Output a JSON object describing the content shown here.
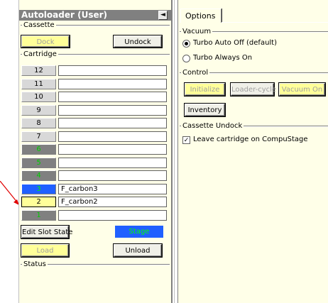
{
  "autoloader": {
    "title": "Autoloader (User)",
    "collapse_glyph": "◄",
    "cassette_label": "Cassette",
    "dock_label": "Dock",
    "undock_label": "Undock",
    "cartridge_label": "Cartridge",
    "slots": [
      {
        "num": "12",
        "name": "",
        "color": "#d8d8d8",
        "text_color": "#000000"
      },
      {
        "num": "11",
        "name": "",
        "color": "#d8d8d8",
        "text_color": "#000000"
      },
      {
        "num": "10",
        "name": "",
        "color": "#d8d8d8",
        "text_color": "#000000"
      },
      {
        "num": "9",
        "name": "",
        "color": "#d8d8d8",
        "text_color": "#000000"
      },
      {
        "num": "8",
        "name": "",
        "color": "#d8d8d8",
        "text_color": "#000000"
      },
      {
        "num": "7",
        "name": "",
        "color": "#d8d8d8",
        "text_color": "#000000"
      },
      {
        "num": "6",
        "name": "",
        "color": "#808080",
        "text_color": "#00cc00"
      },
      {
        "num": "5",
        "name": "",
        "color": "#808080",
        "text_color": "#00cc00"
      },
      {
        "num": "4",
        "name": "",
        "color": "#808080",
        "text_color": "#00cc00"
      },
      {
        "num": "3",
        "name": "F_carbon3",
        "color": "#2060ff",
        "text_color": "#00ee00"
      },
      {
        "num": "2",
        "name": "F_carbon2",
        "color": "#ffff99",
        "text_color": "#000000"
      },
      {
        "num": "1",
        "name": "",
        "color": "#808080",
        "text_color": "#00cc00"
      }
    ],
    "edit_slot_state_label": "Edit Slot State",
    "stage_label": "Stage",
    "stage_color": "#2060ff",
    "load_label": "Load",
    "unload_label": "Unload",
    "status_label": "Status"
  },
  "options": {
    "tab_label": "Options",
    "vacuum_label": "Vacuum",
    "radio_1": {
      "label": "Turbo Auto Off (default)",
      "selected": true
    },
    "radio_2": {
      "label": "Turbo Always On",
      "selected": false
    },
    "control_label": "Control",
    "initialize_label": "Initialize",
    "loader_cycle_label": "Loader-cycle",
    "vacuum_on_label": "Vacuum On",
    "inventory_label": "Inventory",
    "cassette_undock_label": "Cassette Undock",
    "leave_cartridge_label": "Leave cartridge on CompuStage",
    "leave_cartridge_checked": true
  },
  "colors": {
    "panel_bg": "#ffffe8",
    "title_bar": "#808080",
    "yellow_button": "#ffff99",
    "arrow": "#e00000"
  }
}
